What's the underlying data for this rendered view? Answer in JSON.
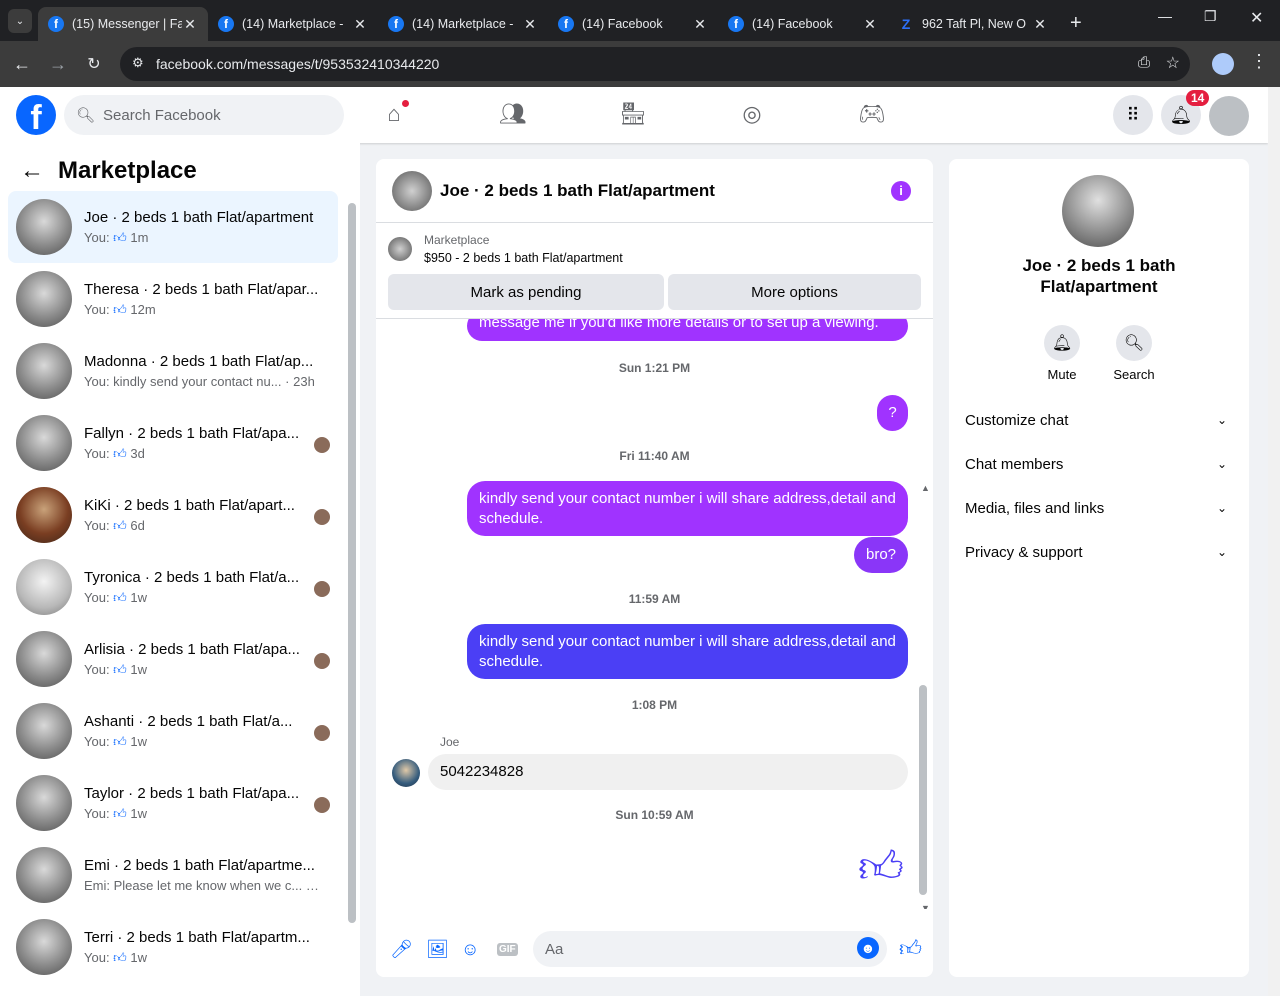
{
  "browser": {
    "tabs": [
      {
        "title": "(15) Messenger | Fa",
        "icon": "facebook-icon",
        "active": true
      },
      {
        "title": "(14) Marketplace -",
        "icon": "facebook-icon"
      },
      {
        "title": "(14) Marketplace -",
        "icon": "facebook-icon"
      },
      {
        "title": "(14) Facebook",
        "icon": "facebook-icon"
      },
      {
        "title": "(14) Facebook",
        "icon": "facebook-icon"
      },
      {
        "title": "962 Taft Pl, New O",
        "icon": "zillow-icon"
      }
    ],
    "url": "facebook.com/messages/t/953532410344220"
  },
  "fb": {
    "logo": "f",
    "search_placeholder": "Search Facebook",
    "notification_count": "14"
  },
  "sidebar": {
    "title": "Marketplace",
    "conversations": [
      {
        "name": "Joe · 2 beds 1 bath Flat/apartment",
        "preview": "You:",
        "time": "1m",
        "like": true,
        "selected": true
      },
      {
        "name": "Theresa · 2 beds 1 bath Flat/apar...",
        "preview": "You:",
        "time": "12m",
        "like": true
      },
      {
        "name": "Madonna · 2 beds 1 bath Flat/ap...",
        "preview": "You: kindly send your contact nu...",
        "time": "· 23h",
        "like": false
      },
      {
        "name": "Fallyn · 2 beds 1 bath Flat/apa...",
        "preview": "You:",
        "time": "3d",
        "like": true,
        "seen": true
      },
      {
        "name": "KiKi · 2 beds 1 bath Flat/apart...",
        "preview": "You:",
        "time": "6d",
        "like": true,
        "seen": true,
        "photo": "wood"
      },
      {
        "name": "Tyronica · 2 beds 1 bath Flat/a...",
        "preview": "You:",
        "time": "1w",
        "like": true,
        "seen": true,
        "photo": "light"
      },
      {
        "name": "Arlisia · 2 beds 1 bath Flat/apa...",
        "preview": "You:",
        "time": "1w",
        "like": true,
        "seen": true
      },
      {
        "name": "Ashanti · 2 beds 1 bath Flat/a...",
        "preview": "You:",
        "time": "1w",
        "like": true,
        "seen": true
      },
      {
        "name": "Taylor · 2 beds 1 bath Flat/apa...",
        "preview": "You:",
        "time": "1w",
        "like": true,
        "seen": true
      },
      {
        "name": "Emi · 2 beds 1 bath Flat/apartme...",
        "preview": "Emi: Please let me know when we c...",
        "time": "· 1w",
        "like": false
      },
      {
        "name": "Terri · 2 beds 1 bath Flat/apartm...",
        "preview": "You:",
        "time": "1w",
        "like": true
      }
    ]
  },
  "chat": {
    "title": "Joe · 2 beds 1 bath Flat/apartment",
    "marketplace_label": "Marketplace",
    "listing": "$950 - 2 beds 1 bath Flat/apartment",
    "btn_pending": "Mark as pending",
    "btn_more": "More options",
    "messages": {
      "partial": "message me if you'd like more details or to set up a viewing.",
      "ts1": "Sun 1:21 PM",
      "q": "?",
      "ts2": "Fri 11:40 AM",
      "m1": "kindly send your contact number i will share address,detail and schedule.",
      "bro": "bro?",
      "ts3": "11:59 AM",
      "m2": "kindly send your contact number i will share address,detail and schedule.",
      "ts4": "1:08 PM",
      "sender": "Joe",
      "phone": "5042234828",
      "ts5": "Sun 10:59 AM"
    },
    "composer_placeholder": "Aa"
  },
  "info_panel": {
    "name": "Joe · 2 beds 1 bath Flat/apartment",
    "mute": "Mute",
    "search": "Search",
    "rows": [
      "Customize chat",
      "Chat members",
      "Media, files and links",
      "Privacy & support"
    ]
  },
  "colors": {
    "fb_blue": "#0866ff",
    "bubble_purple": "#a033ff",
    "bubble_blue": "#4b3ff5"
  }
}
